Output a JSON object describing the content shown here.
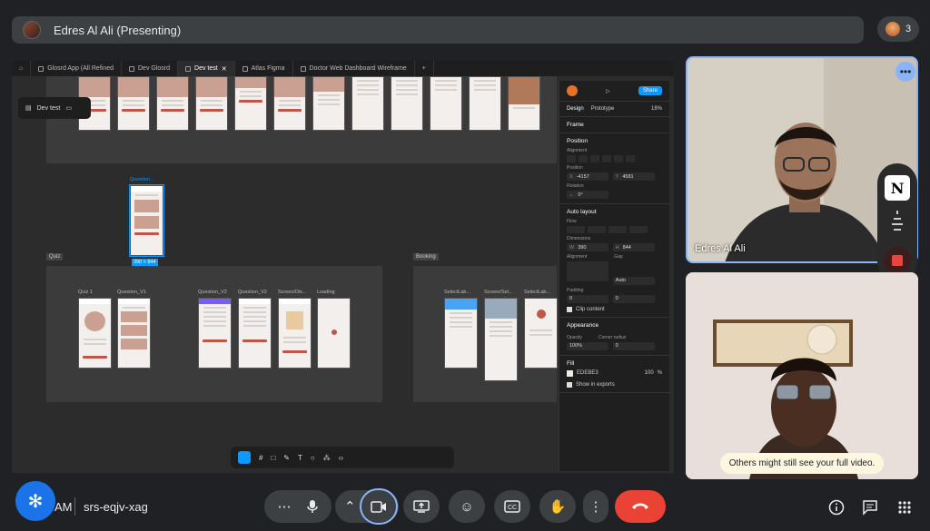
{
  "top_bar": {
    "presenter_title": "Edres Al Ali (Presenting)",
    "participant_count": "3"
  },
  "figma": {
    "tabs": [
      "Glosrd App (All Refined",
      "Dev Glosrd",
      "Dev test",
      "Atlas Figma",
      "Doctor Web Dashboard Wireframe"
    ],
    "active_tab_index": 2,
    "layer_pill": "Dev test",
    "frames": {
      "quiz_label": "Quiz",
      "booking_label": "Booking",
      "selected_label": "Question...",
      "selected_size": "390 × 844",
      "quiz_screens": [
        "Quiz 1",
        "Question_V1",
        "Question_V2",
        "Question_V2",
        "Screen/Dis...",
        "Loading"
      ],
      "booking_screens": [
        "SelectLab...",
        "Screen/Sel...",
        "SelectLab..."
      ]
    },
    "panel": {
      "share": "Share",
      "zoom": "18%",
      "tabs": [
        "Design",
        "Prototype"
      ],
      "frame_label": "Frame",
      "position_title": "Position",
      "alignment_label": "Alignment",
      "position_label": "Position",
      "x_label": "X",
      "x": "-4157",
      "y_label": "Y",
      "y": "4581",
      "rotation_label": "Rotation",
      "rotation": "0°",
      "auto_layout_title": "Auto layout",
      "flow_label": "Flow",
      "dimensions_label": "Dimensions",
      "w_label": "W",
      "w": "390",
      "h_label": "H",
      "h": "844",
      "gap_label": "Gap",
      "gap": "Auto",
      "padding_label": "Padding",
      "padding_h": "0",
      "padding_v": "0",
      "clip_content": "Clip content",
      "appearance_title": "Appearance",
      "opacity_label": "Opacity",
      "opacity": "100%",
      "corner_radius_label": "Corner radius",
      "corner_radius": "0",
      "fill_title": "Fill",
      "fill_hex": "EDEBE3",
      "fill_opacity": "100",
      "fill_opacity_unit": "%",
      "show_in_exports": "Show in exports"
    }
  },
  "tiles": {
    "tile1_name": "Edres Al Ali",
    "warning": "Others might still see your full video."
  },
  "bottom_bar": {
    "time_fragment": "AM",
    "meeting_code": "srs-eqjv-xag"
  },
  "colors": {
    "end_call": "#ea4335",
    "fab": "#1a73e8",
    "figma_accent": "#0d99ff",
    "active_border": "#8ab4f8"
  },
  "icons": [
    "presenter-avatar",
    "more-vert-icon",
    "notion-icon",
    "record-icon",
    "sparkle-icon",
    "more-options-icon",
    "mic-icon",
    "chevron-up-icon",
    "camera-icon",
    "present-icon",
    "emoji-icon",
    "captions-icon",
    "hand-icon",
    "end-call-icon",
    "info-icon",
    "chat-icon",
    "apps-icon"
  ]
}
